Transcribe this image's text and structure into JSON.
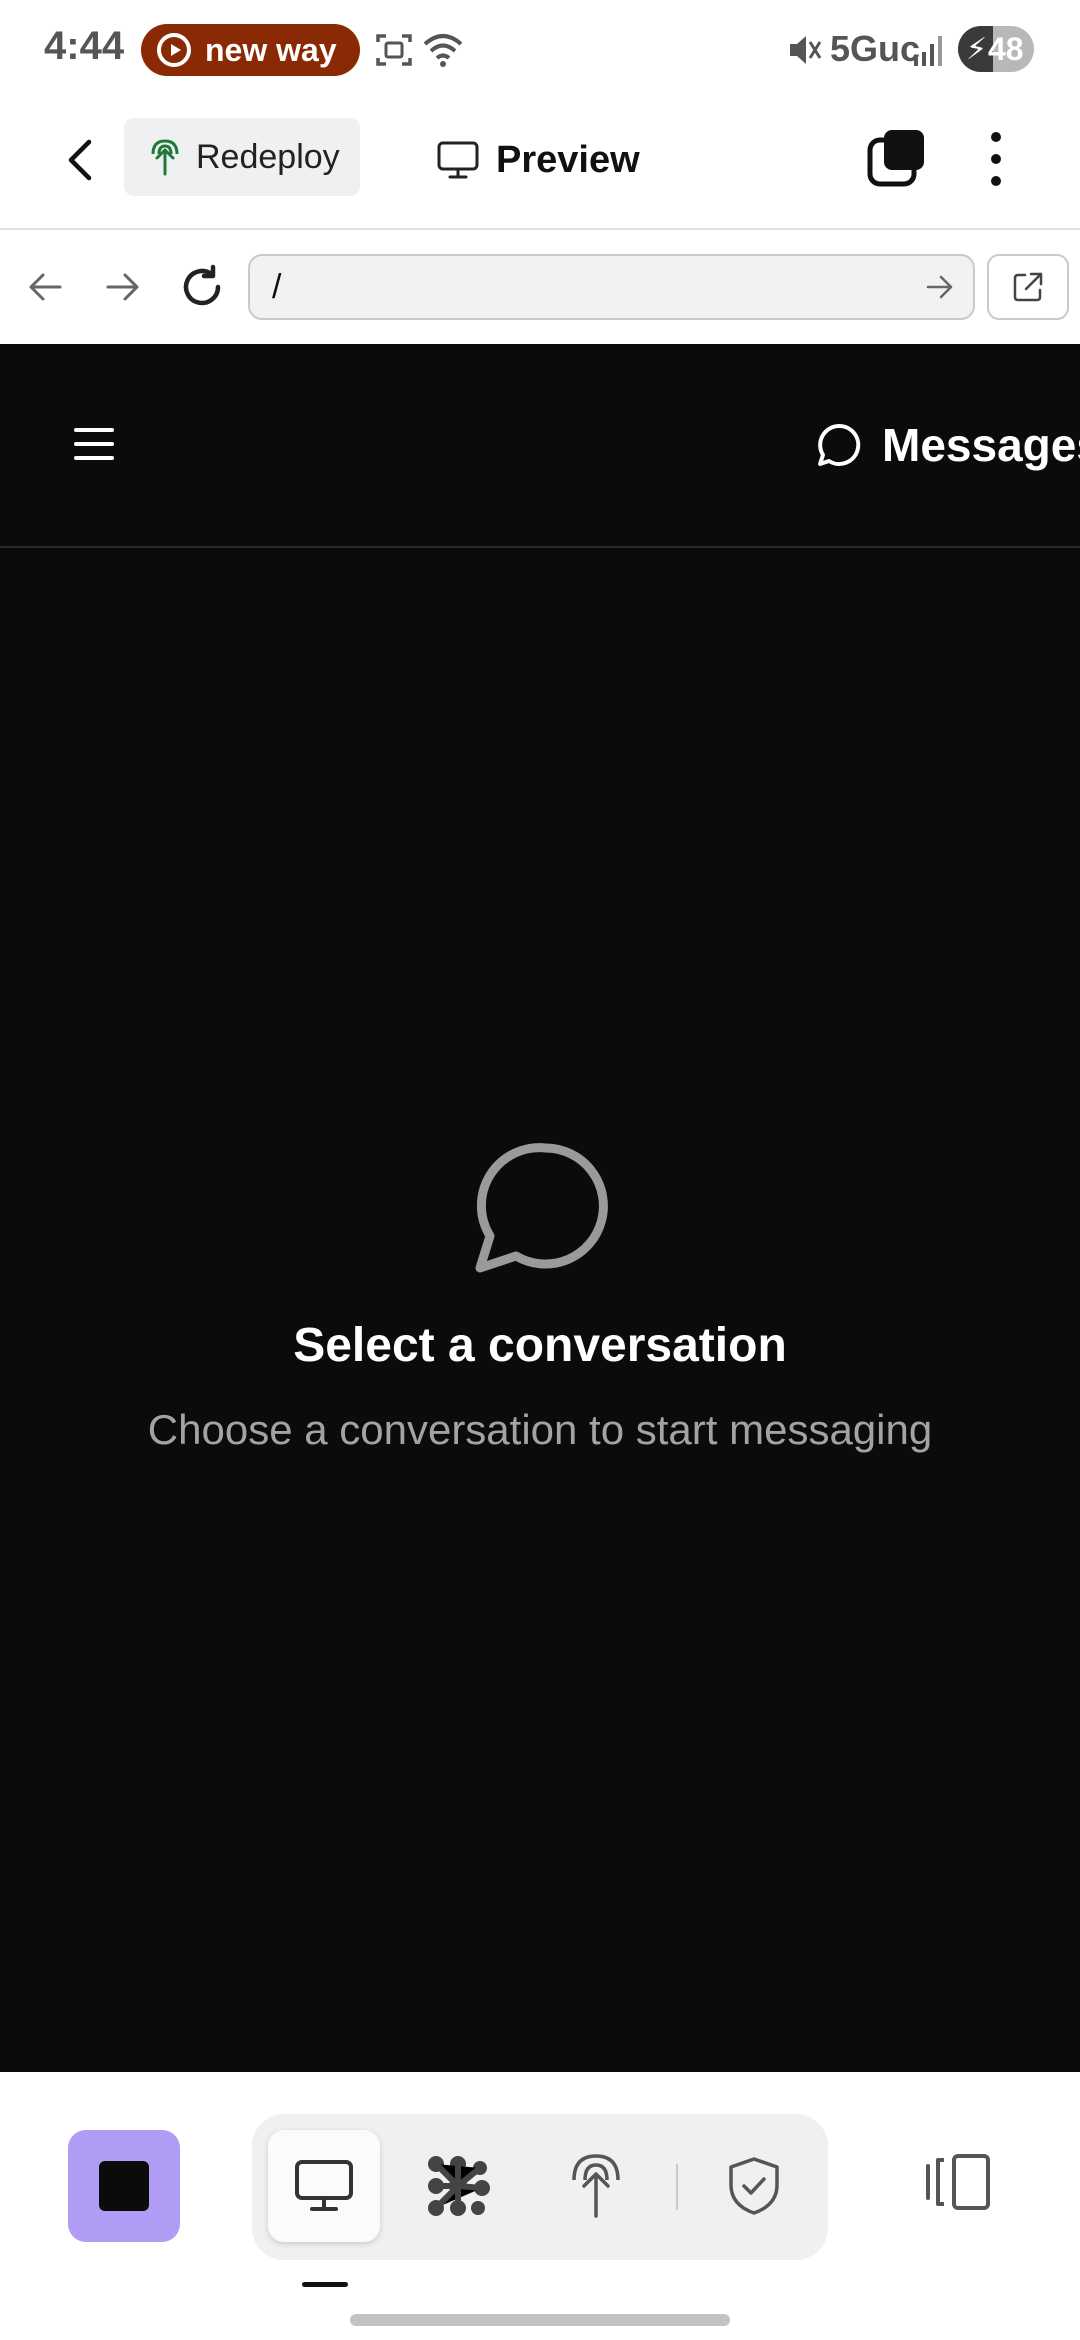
{
  "status_bar": {
    "time": "4:44",
    "media_pill": {
      "label": "new way",
      "color": "#8a2a05"
    },
    "network": "5Guc",
    "battery": "48"
  },
  "header": {
    "redeploy_label": "Redeploy",
    "preview_label": "Preview"
  },
  "browser": {
    "url": "/"
  },
  "web_app": {
    "background": "#0b0b0b",
    "messages_label": "Messages",
    "empty_title": "Select a conversation",
    "empty_subtitle": "Choose a conversation to start messaging"
  },
  "toolbar": {
    "stop_color": "#b09cf4",
    "tools": [
      "desktop-icon",
      "integrations-icon",
      "deploy-icon",
      "shield-check-icon"
    ],
    "active_tool": "desktop-icon"
  }
}
